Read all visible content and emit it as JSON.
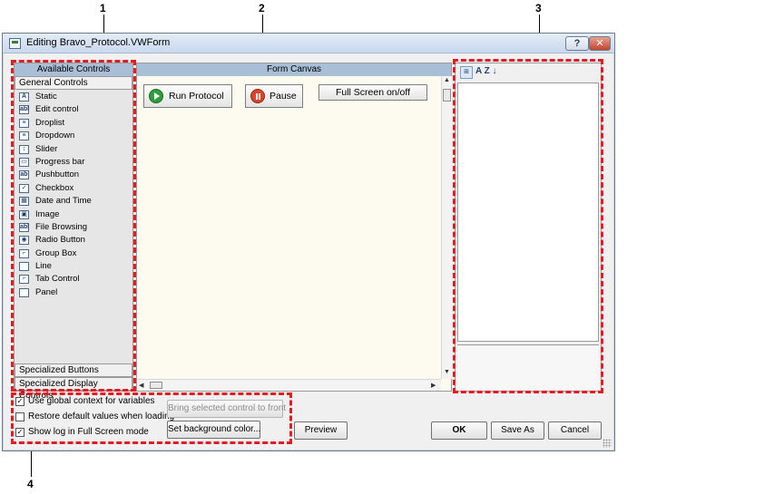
{
  "callouts": [
    "1",
    "2",
    "3",
    "4"
  ],
  "window": {
    "title": "Editing Bravo_Protocol.VWForm",
    "help_label": "?",
    "close_label": "✕"
  },
  "left_panel": {
    "header": "Available Controls",
    "section": "General Controls",
    "items": [
      {
        "icon": "A",
        "label": "Static"
      },
      {
        "icon": "abl",
        "label": "Edit control"
      },
      {
        "icon": "≡",
        "label": "Droplist"
      },
      {
        "icon": "≡",
        "label": "Dropdown"
      },
      {
        "icon": "↕",
        "label": "Slider"
      },
      {
        "icon": "▭",
        "label": "Progress bar"
      },
      {
        "icon": "ab",
        "label": "Pushbutton"
      },
      {
        "icon": "✓",
        "label": "Checkbox"
      },
      {
        "icon": "▦",
        "label": "Date and Time"
      },
      {
        "icon": "▣",
        "label": "Image"
      },
      {
        "icon": "abl",
        "label": "File Browsing"
      },
      {
        "icon": "◉",
        "label": "Radio Button"
      },
      {
        "icon": "⌐",
        "label": "Group Box"
      },
      {
        "icon": "",
        "label": "Line"
      },
      {
        "icon": "⌐",
        "label": "Tab Control"
      },
      {
        "icon": "",
        "label": "Panel"
      }
    ],
    "bottom_sections": [
      "Specialized Buttons",
      "Specialized Display Controls"
    ]
  },
  "canvas": {
    "header": "Form Canvas",
    "run_label": "Run Protocol",
    "pause_label": "Pause",
    "fullscreen_label": "Full Screen on/off"
  },
  "prop_panel": {
    "cat_icon": "⊞",
    "sort_icon": "A Z ↓"
  },
  "bottom": {
    "checkboxes": [
      {
        "label": "Use global context for variables",
        "mark": "✓"
      },
      {
        "label": "Restore default values when loading",
        "mark": ""
      },
      {
        "label": "Show log in Full Screen mode",
        "mark": "✓"
      }
    ],
    "bring_front_label": "Bring selected control to front",
    "bg_color_label": "Set background color...",
    "preview_label": "Preview",
    "ok_label": "OK",
    "save_as_label": "Save As",
    "cancel_label": "Cancel"
  },
  "accent_color": "#e31b23"
}
